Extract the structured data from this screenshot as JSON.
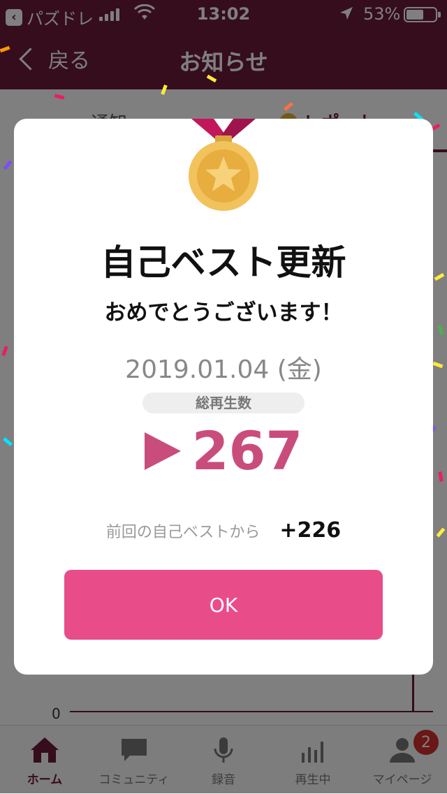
{
  "status_bar": {
    "back_app": "パズドレ",
    "time": "13:02",
    "battery_pct": "53%"
  },
  "nav": {
    "back_label": "戻る",
    "title": "お知らせ"
  },
  "tabs": [
    {
      "label": "通知"
    },
    {
      "label": "レポート"
    }
  ],
  "chart": {
    "zero_label": "0"
  },
  "tab_bar": [
    {
      "label": "ホーム",
      "icon": "home-icon"
    },
    {
      "label": "コミュニティ",
      "icon": "chat-icon"
    },
    {
      "label": "録音",
      "icon": "microphone-icon"
    },
    {
      "label": "再生中",
      "icon": "equalizer-icon"
    },
    {
      "label": "マイページ",
      "icon": "user-icon",
      "badge": "2"
    }
  ],
  "modal": {
    "heading": "自己ベスト更新",
    "subheading": "おめでとうございます！",
    "date": "2019.01.04 (金)",
    "metric_label": "総再生数",
    "count": "267",
    "diff_label": "前回の自己ベストから",
    "diff_value": "+226",
    "ok_label": "OK"
  },
  "colors": {
    "brand": "#6b1b3a",
    "accent_pink": "#e84d8a",
    "count_pink": "#c94d7c",
    "medal_gold": "#f2c25c"
  }
}
